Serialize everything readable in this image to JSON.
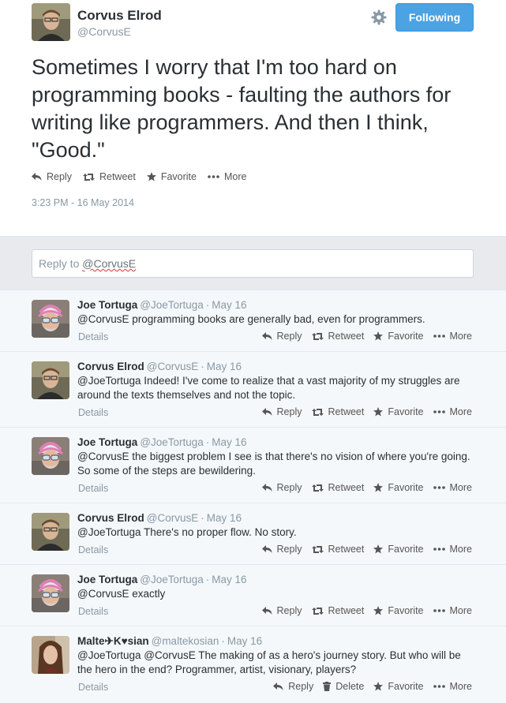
{
  "tweet": {
    "author_name": "Corvus Elrod",
    "author_handle": "@CorvusE",
    "follow_label": "Following",
    "text": "Sometimes I worry that I'm too hard on programming books - faulting the authors for writing like programmers. And then I think, \"Good.\"",
    "actions": {
      "reply": "Reply",
      "retweet": "Retweet",
      "favorite": "Favorite",
      "more": "More"
    },
    "timestamp": "3:23 PM - 16 May 2014"
  },
  "reply_box": {
    "prefix": "Reply to ",
    "mention": "@CorvusE"
  },
  "replies": [
    {
      "name": "Joe Tortuga",
      "handle": "@JoeTortuga",
      "date": "May 16",
      "text": "@CorvusE programming books are generally bad, even for programmers.",
      "details": "Details",
      "actions": [
        "Reply",
        "Retweet",
        "Favorite",
        "More"
      ]
    },
    {
      "name": "Corvus Elrod",
      "handle": "@CorvusE",
      "date": "May 16",
      "text": "@JoeTortuga Indeed! I've come to realize that a vast majority of my struggles are around the texts themselves and not the topic.",
      "details": "Details",
      "actions": [
        "Reply",
        "Retweet",
        "Favorite",
        "More"
      ]
    },
    {
      "name": "Joe Tortuga",
      "handle": "@JoeTortuga",
      "date": "May 16",
      "text": "@CorvusE the biggest problem I see is that there's no vision of where you're going. So some of the steps are bewildering.",
      "details": "Details",
      "actions": [
        "Reply",
        "Retweet",
        "Favorite",
        "More"
      ]
    },
    {
      "name": "Corvus Elrod",
      "handle": "@CorvusE",
      "date": "May 16",
      "text": "@JoeTortuga There's no proper flow. No story.",
      "details": "Details",
      "actions": [
        "Reply",
        "Retweet",
        "Favorite",
        "More"
      ]
    },
    {
      "name": "Joe Tortuga",
      "handle": "@JoeTortuga",
      "date": "May 16",
      "text": "@CorvusE exactly",
      "details": "Details",
      "actions": [
        "Reply",
        "Retweet",
        "Favorite",
        "More"
      ]
    },
    {
      "name": "Malte✈K♥sian",
      "handle": "@maltekosian",
      "date": "May 16",
      "text": "@JoeTortuga @CorvusE The making of as a hero's journey story. But who will be the hero in the end? Programmer, artist, visionary, players?",
      "details": "Details",
      "actions": [
        "Reply",
        "Delete",
        "Favorite",
        "More"
      ]
    }
  ],
  "colors": {
    "accent": "#4ba3e3",
    "text": "#292f33",
    "muted": "#8899a6",
    "reply_bg": "#f5f8fa"
  }
}
